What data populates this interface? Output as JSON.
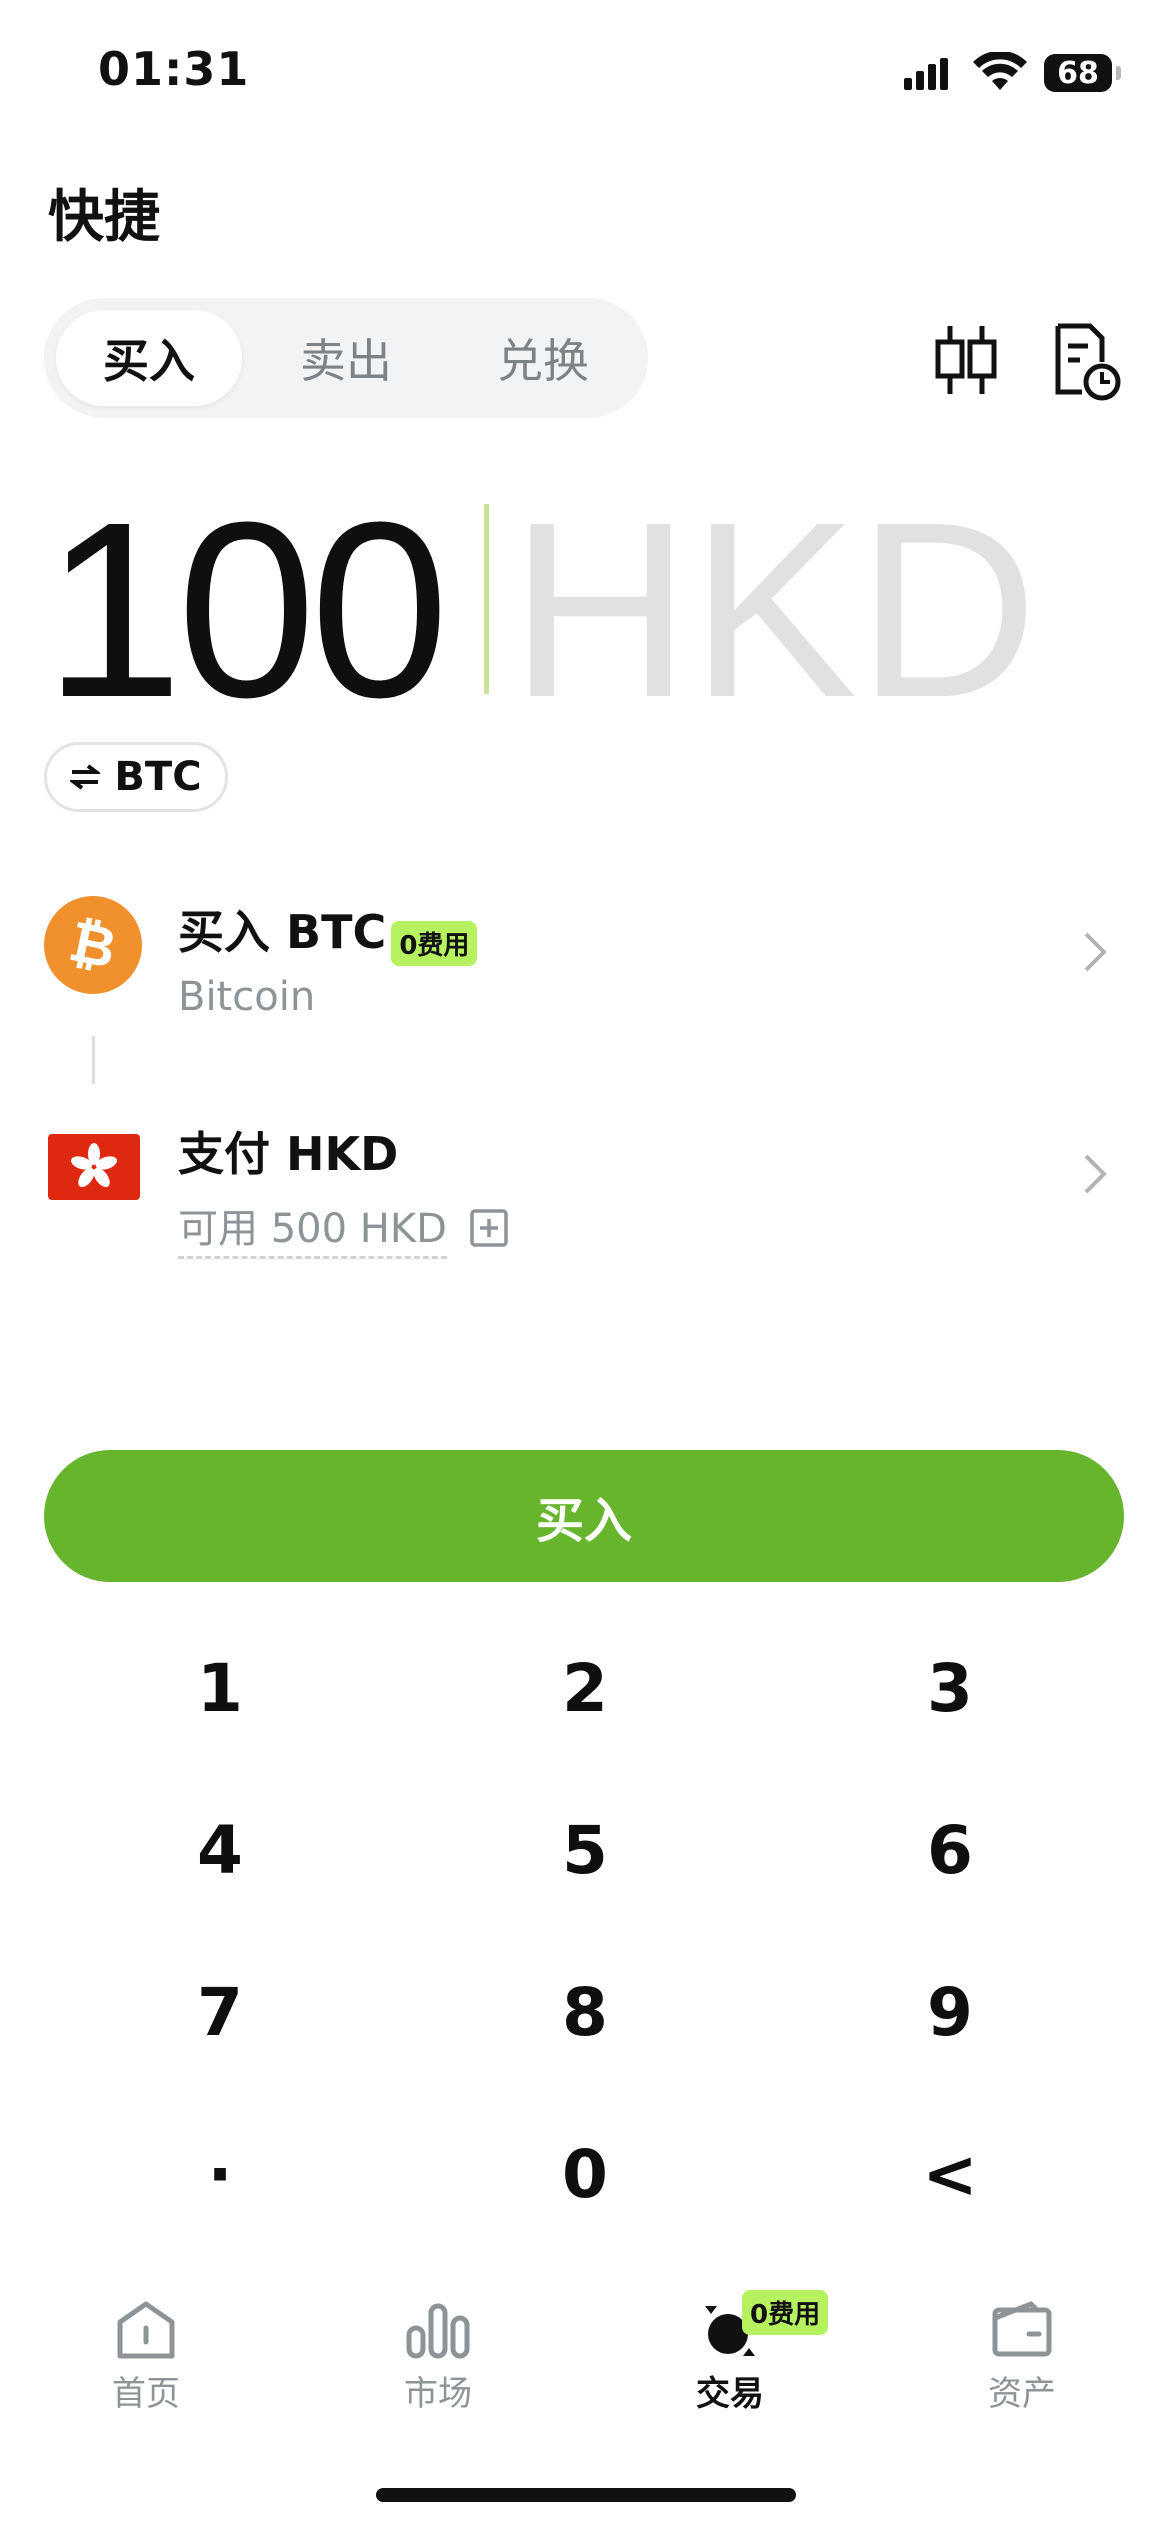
{
  "status_bar": {
    "time": "01:31",
    "battery": "68"
  },
  "page": {
    "title": "快捷"
  },
  "tabs": [
    {
      "label": "买入",
      "active": true
    },
    {
      "label": "卖出",
      "active": false
    },
    {
      "label": "兑换",
      "active": false
    }
  ],
  "header_icons": {
    "chart": "candlestick-chart-icon",
    "history": "order-history-icon"
  },
  "amount": {
    "value": "100",
    "currency": "HKD"
  },
  "asset_chip": {
    "label": "BTC",
    "icon": "swap-icon"
  },
  "buy_row": {
    "title": "买入 BTC",
    "badge": "0费用",
    "subtitle": "Bitcoin",
    "icon": "bitcoin-icon"
  },
  "pay_row": {
    "title": "支付 HKD",
    "subtitle": "可用 500 HKD",
    "icon": "hong-kong-flag-icon"
  },
  "buy_button": {
    "label": "买入"
  },
  "keypad": [
    "1",
    "2",
    "3",
    "4",
    "5",
    "6",
    "7",
    "8",
    "9",
    "·",
    "0",
    "<"
  ],
  "bottom_nav": {
    "items": [
      {
        "label": "首页",
        "icon": "home-icon",
        "active": false
      },
      {
        "label": "市场",
        "icon": "market-bars-icon",
        "active": false
      },
      {
        "label": "交易",
        "icon": "trade-icon",
        "active": true
      },
      {
        "label": "资产",
        "icon": "wallet-icon",
        "active": false
      }
    ],
    "badge": "0费用"
  },
  "colors": {
    "accent_green": "#67b52d",
    "badge_green": "#b6f25f",
    "bitcoin_orange": "#f0912d",
    "flag_red": "#de2910"
  }
}
